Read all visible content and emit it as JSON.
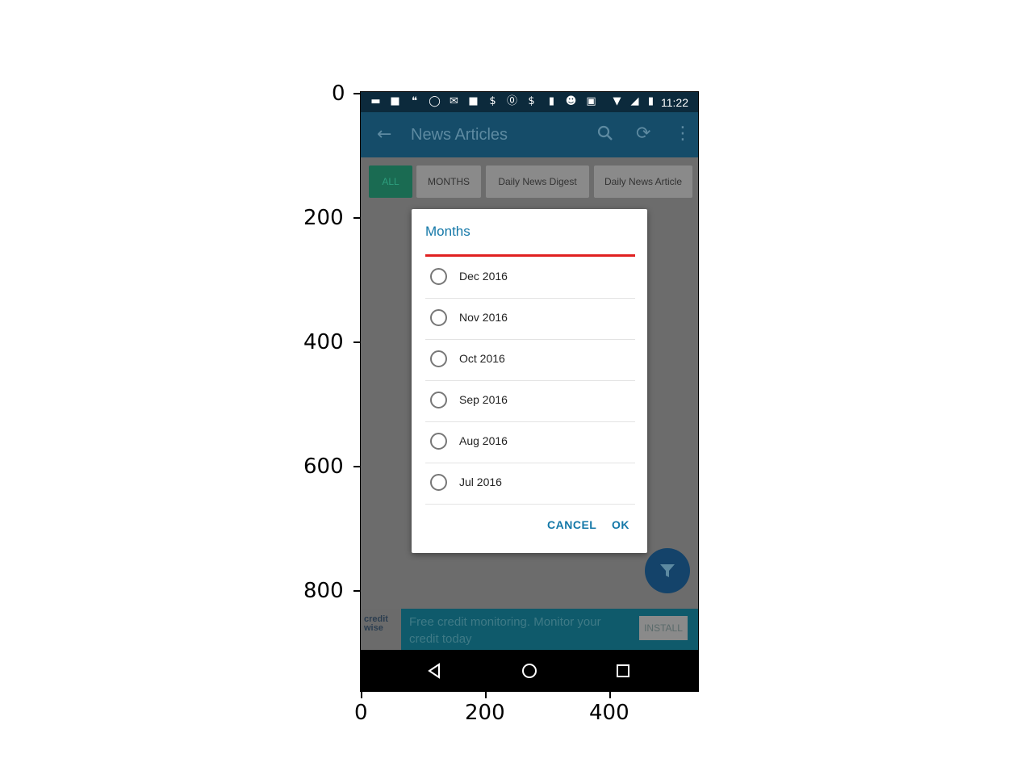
{
  "axes": {
    "y_ticks": [
      "0",
      "200",
      "400",
      "600",
      "800"
    ],
    "x_ticks": [
      "0",
      "200",
      "400"
    ]
  },
  "status_bar": {
    "time": "11:22",
    "icons": [
      "messenger-icon",
      "flipboard-icon",
      "quote-icon",
      "whatsapp-icon",
      "gmail-icon",
      "flipboard-icon",
      "money-bag-icon",
      "pinterest-icon",
      "money-bag-icon",
      "sim-icon",
      "cat-icon",
      "linkedin-icon",
      "wifi-icon",
      "signal-off-icon",
      "battery-charging-icon"
    ]
  },
  "app_bar": {
    "title": "News Articles",
    "icons": [
      "back-arrow-icon",
      "search-icon",
      "refresh-icon",
      "overflow-menu-icon"
    ]
  },
  "tabs": [
    {
      "label": "ALL"
    },
    {
      "label": "MONTHS"
    },
    {
      "label": "Daily News Digest"
    },
    {
      "label": "Daily News Article"
    }
  ],
  "dialog": {
    "title": "Months",
    "options": [
      "Dec 2016",
      "Nov 2016",
      "Oct 2016",
      "Sep 2016",
      "Aug 2016",
      "Jul 2016"
    ],
    "cancel_label": "CANCEL",
    "ok_label": "OK"
  },
  "fab": {
    "icon": "filter-icon"
  },
  "ad": {
    "brand": "credit wise",
    "text": "Free credit monitoring. Monitor your credit today",
    "install_label": "INSTALL"
  },
  "nav_bar": {
    "icons": [
      "back-triangle-icon",
      "home-circle-icon",
      "recents-square-icon"
    ]
  },
  "colors": {
    "app_bar": "#154c69",
    "status_bar": "#0c2a3c",
    "accent": "#1478a8",
    "divider_red": "#e02020",
    "tab_selected": "#1a6b52",
    "fab": "#14436a",
    "ad_banner": "#0f5a6b",
    "scrim": "#6c6c6c"
  }
}
